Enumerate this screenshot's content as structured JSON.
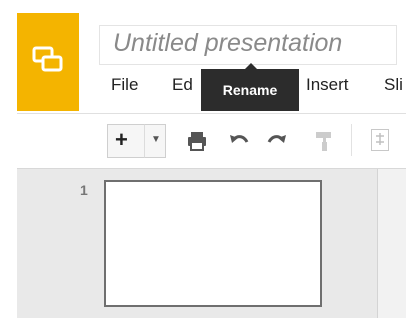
{
  "app": {
    "title": "Untitled presentation"
  },
  "menu": {
    "items": [
      "File",
      "Ed",
      "Insert",
      "Sli"
    ]
  },
  "tooltip": {
    "text": "Rename"
  },
  "toolbar": {
    "new_label": "+",
    "tools": [
      "printer-icon",
      "undo-icon",
      "redo-icon",
      "paint-format-icon"
    ]
  },
  "slides": [
    {
      "number": "1"
    }
  ],
  "colors": {
    "brand": "#f4b400",
    "tooltip_bg": "#2c2c2c",
    "filmstrip_bg": "#e9e9e9"
  }
}
